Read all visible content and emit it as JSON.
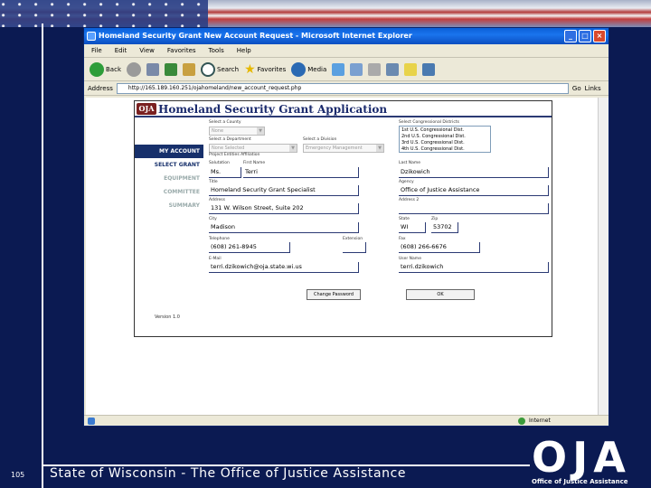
{
  "slide": {
    "number": "105",
    "footer": "State of Wisconsin - The Office of Justice Assistance",
    "logo_text": "OJA",
    "logo_tagline": "Office of Justice Assistance"
  },
  "window": {
    "title": "Homeland Security Grant New Account Request - Microsoft Internet Explorer",
    "menu": [
      "File",
      "Edit",
      "View",
      "Favorites",
      "Tools",
      "Help"
    ],
    "toolbar": {
      "back": "Back",
      "search": "Search",
      "favorites": "Favorites",
      "media": "Media"
    },
    "address_label": "Address",
    "address_value": "http://165.189.160.251/ojahomeland/new_account_request.php",
    "go_label": "Go",
    "links_label": "Links",
    "status_text": "Internet"
  },
  "app": {
    "logo": "OJA",
    "title": "Homeland Security Grant Application",
    "nav": [
      "MY ACCOUNT",
      "SELECT GRANT",
      "EQUIPMENT",
      "COMMITTEE",
      "SUMMARY"
    ],
    "version": "Version 1.0",
    "labels": {
      "county": "Select a County",
      "type": "Select a Department",
      "division": "Select a Division",
      "districts": "Select Congressional Districts",
      "description": "Project Entities Affiliation",
      "salutation": "Salutation",
      "first": "First Name",
      "last": "Last Name",
      "title": "Title",
      "agency": "Agency",
      "address": "Address",
      "address2": "Address 2",
      "city": "City",
      "state": "State",
      "zip": "Zip",
      "phone": "Telephone",
      "ext": "Extension",
      "fax": "Fax",
      "email": "E-Mail",
      "username": "User Name"
    },
    "selects": {
      "county": "None",
      "type": "None Selected",
      "division": "Emergency Management"
    },
    "districts": [
      "1st U.S. Congressional Dist.",
      "2nd U.S. Congressional Dist.",
      "3rd U.S. Congressional Dist.",
      "4th U.S. Congressional Dist."
    ],
    "values": {
      "salutation": "Ms.",
      "first": "Terri",
      "last": "Dzikowich",
      "title": "Homeland Security Grant Specialist",
      "agency": "Office of Justice Assistance",
      "address": "131 W. Wilson Street, Suite 202",
      "address2": "",
      "city": "Madison",
      "state": "WI",
      "zip": "53702",
      "phone": "(608) 261-8945",
      "ext": "",
      "fax": "(608) 266-6676",
      "email": "terri.dzikowich@oja.state.wi.us",
      "username": "terri.dzikowich"
    },
    "buttons": {
      "change_password": "Change Password",
      "ok": "OK"
    }
  }
}
